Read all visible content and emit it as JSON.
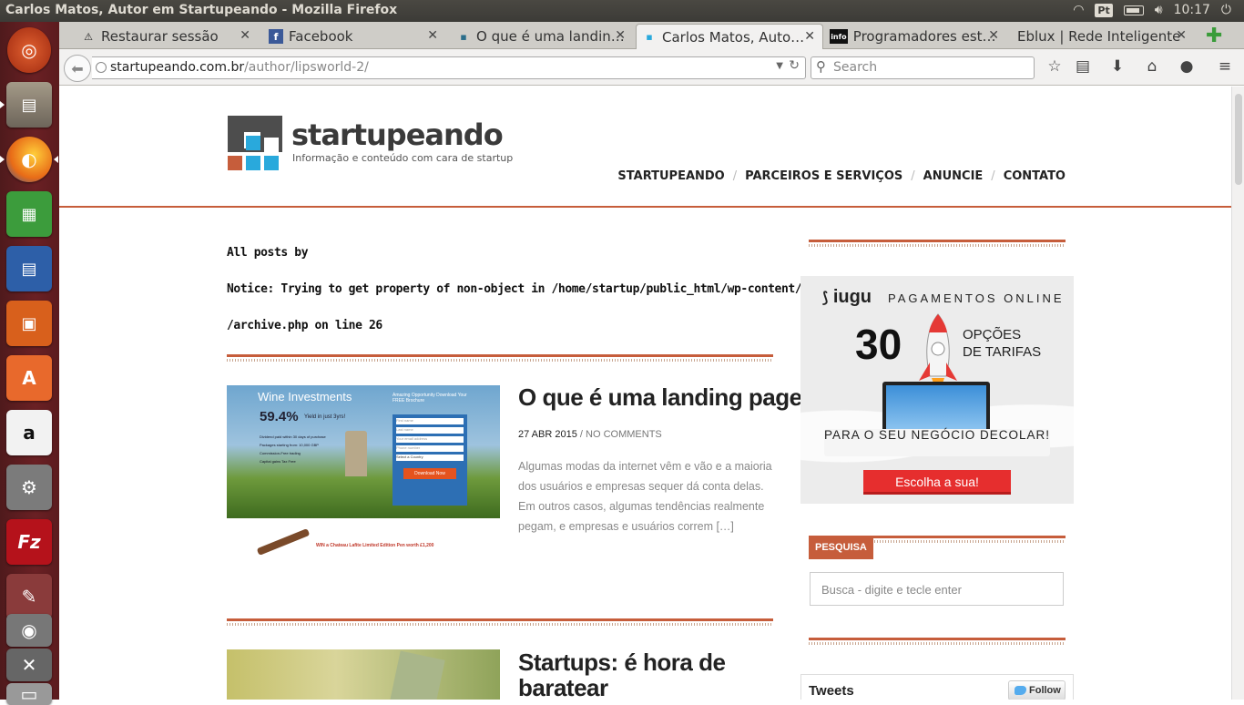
{
  "system": {
    "window_title": "Carlos Matos, Autor em Startupeando - Mozilla Firefox",
    "keyboard_layout": "Pt",
    "clock": "10:17"
  },
  "tabs": [
    {
      "label": "Restaurar sessão",
      "icon": "warning-icon"
    },
    {
      "label": "Facebook",
      "icon": "facebook-icon"
    },
    {
      "label": "O que é uma landin…",
      "icon": "page-icon"
    },
    {
      "label": "Carlos Matos, Auto…",
      "icon": "startupeando-icon"
    },
    {
      "label": "Programadores est…",
      "icon": "info-icon"
    },
    {
      "label": "Eblux | Rede Inteligente",
      "icon": "page-icon"
    }
  ],
  "navbar": {
    "url_host": "startupeando.com.br",
    "url_path": "/author/lipsworld-2/",
    "search_placeholder": "Search"
  },
  "site": {
    "logo_text": "startupeando",
    "tagline": "Informação e conteúdo com cara de startup",
    "menu": [
      "STARTUPEANDO",
      "PARCEIROS E SERVIÇOS",
      "ANUNCIE",
      "CONTATO"
    ]
  },
  "archive": {
    "heading": "All posts by",
    "notice_line1": "Notice: Trying to get property of non-object in /home/startup/public_html/wp-content/themes/viewport",
    "notice_line2": "/archive.php on line 26"
  },
  "posts": [
    {
      "title": "O que é uma landing page?",
      "date": "27 ABR 2015",
      "comments": "NO COMMENTS",
      "excerpt": "Algumas modas da internet vêm e vão e a maioria dos usuários e empresas sequer dá conta delas. Em outros casos, algumas tendências realmente pegam, e empresas e usuários correm […]",
      "thumb": {
        "heading": "Wine Investments",
        "stat": "59.4%",
        "stat_caption": "Yield in just 3yrs!",
        "bullets": [
          "Dividend paid within 30 days of purchase",
          "Packages starting from: 10,000 GBP",
          "Commission-Free trading",
          "Capital gains Tax Free"
        ],
        "form_title": "Amazing Opportunity Download Your FREE Brochure",
        "fields": [
          "First name",
          "Last name",
          "Your email address",
          "Phone number",
          "Select a Country"
        ],
        "cta": "Download Now",
        "win": "WIN a Chateau Lafite Limited Edition Pen worth £1,200"
      }
    },
    {
      "title_line1": "Startups: é hora de",
      "title_line2": "baratear"
    }
  ],
  "sidebar": {
    "ad": {
      "brand": "iugu",
      "tagline": "PAGAMENTOS ONLINE",
      "number": "30",
      "options": "OPÇÕES",
      "options2": "DE TARIFAS",
      "subline": "PARA O SEU NEGÓCIO DECOLAR!",
      "cta": "Escolha a sua!"
    },
    "search_label": "PESQUISA",
    "search_placeholder": "Busca - digite e tecle enter",
    "tweets_title": "Tweets",
    "follow_label": "Follow"
  },
  "colors": {
    "accent": "#c65d3b",
    "launcher": "#5b1b1e",
    "cta_red": "#e62e2e",
    "logo_blue": "#29a9dc"
  }
}
